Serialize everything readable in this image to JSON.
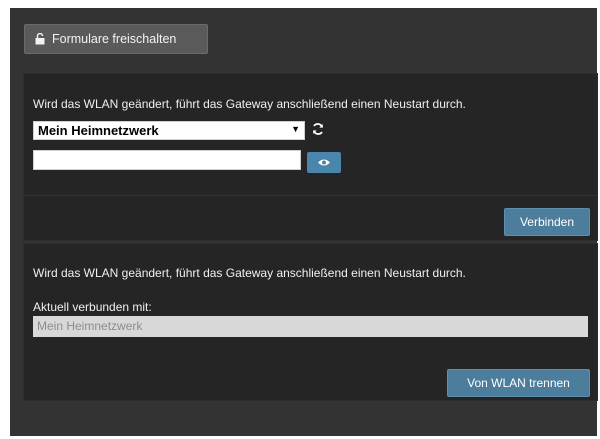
{
  "toolbar": {
    "unlock_label": "Formulare freischalten",
    "unlock_icon": "lock-open-icon"
  },
  "connect_panel": {
    "message": "Wird das WLAN geändert, führt das Gateway anschließend einen Neustart durch.",
    "network_select": {
      "selected": "Mein Heimnetzwerk"
    },
    "refresh_icon": "refresh-icon",
    "password": {
      "value": "",
      "placeholder": ""
    },
    "show_password_icon": "eye-icon",
    "connect_label": "Verbinden"
  },
  "disconnect_panel": {
    "message": "Wird das WLAN geändert, führt das Gateway anschließend einen Neustart durch.",
    "current_label": "Aktuell verbunden mit:",
    "current_value": "Mein Heimnetzwerk",
    "disconnect_label": "Von WLAN trennen"
  },
  "colors": {
    "background": "#333333",
    "panel": "#252525",
    "accent": "#4c7d9c"
  }
}
